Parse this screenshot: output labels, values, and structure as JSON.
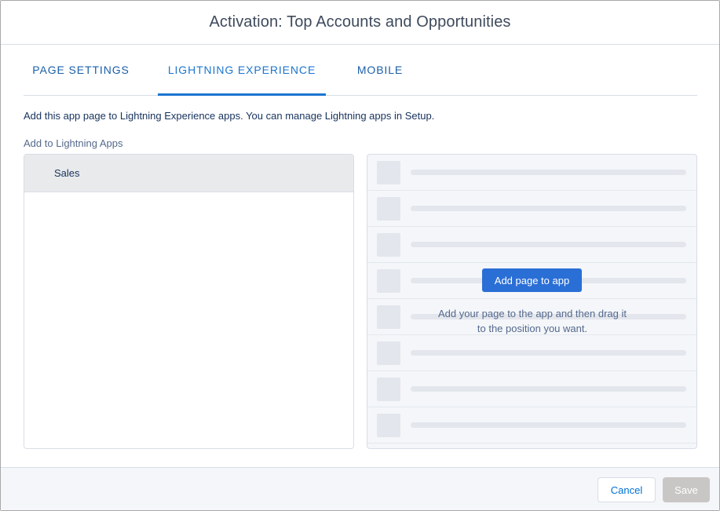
{
  "modal": {
    "title": "Activation: Top Accounts and Opportunities"
  },
  "tabs": [
    {
      "label": "PAGE SETTINGS",
      "active": false
    },
    {
      "label": "LIGHTNING EXPERIENCE",
      "active": true
    },
    {
      "label": "MOBILE",
      "active": false
    }
  ],
  "content": {
    "description": "Add this app page to Lightning Experience apps. You can manage Lightning apps in Setup.",
    "section_label": "Add to Lightning Apps",
    "apps": [
      {
        "label": "Sales",
        "selected": true
      }
    ]
  },
  "preview": {
    "add_button_label": "Add page to app",
    "help_line1": "Add your page to the app and then drag it",
    "help_line2": "to the position you want."
  },
  "footer": {
    "cancel_label": "Cancel",
    "save_label": "Save",
    "save_disabled": true
  },
  "colors": {
    "accent": "#1b75d0",
    "button_primary": "#2a6fd6",
    "text_dark": "#16325c",
    "text_muted": "#54698d"
  }
}
